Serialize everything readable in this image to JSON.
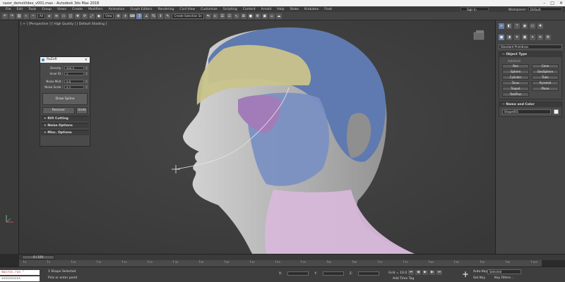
{
  "window": {
    "title": "razor_demoVideo_v001.max - Autodesk 3ds Max 2018"
  },
  "menu": [
    "File",
    "Edit",
    "Tools",
    "Group",
    "Views",
    "Create",
    "Modifiers",
    "Animation",
    "Graph Editors",
    "Rendering",
    "Civil View",
    "Customize",
    "Scripting",
    "Content",
    "Arnold",
    "Help",
    "Stoke",
    "Krakatoa",
    "Frost"
  ],
  "signin": "Sign In",
  "workspace": {
    "label": "Workspaces:",
    "value": "Default"
  },
  "toolbar": {
    "filter": "All",
    "view": "View",
    "selection_set": "Create Selection Se"
  },
  "viewport": {
    "label": "[ + ] [Perspective ] [ High Quality ] [ Default Shading ]"
  },
  "razor": {
    "title": "RaZoR",
    "close": "×",
    "params": [
      {
        "label": "Density :",
        "value": "400.0"
      },
      {
        "label": "Inner ID :",
        "value": "2"
      },
      {
        "label": "Noise Mult :",
        "value": "0.6"
      },
      {
        "label": "Noise Scale :",
        "value": "5.3"
      }
    ],
    "draw_button": "Draw Spline",
    "recover_button": "Recover",
    "undo_button": "Undo",
    "sections": [
      "Rift Cutting",
      "Noise Options",
      "Misc. Options"
    ]
  },
  "command_panel": {
    "dropdown": "Standard Primitives",
    "object_type": {
      "header": "Object Type",
      "autogrid": "AutoGrid",
      "buttons": [
        "Box",
        "Cone",
        "Sphere",
        "GeoSphere",
        "Cylinder",
        "Tube",
        "Torus",
        "Pyramid",
        "Teapot",
        "Plane",
        "TextPlus"
      ]
    },
    "name_color": {
      "header": "Name and Color",
      "name": "Shape001",
      "swatch_color": "#f5f5f5"
    }
  },
  "timeline": {
    "frame": "0 / 100",
    "ticks": [
      "0",
      "5",
      "10",
      "15",
      "20",
      "25",
      "30",
      "35",
      "40",
      "45",
      "50",
      "55",
      "60",
      "65",
      "70",
      "75",
      "80",
      "85",
      "90",
      "95",
      "100"
    ]
  },
  "status": {
    "script_a": "macros.run \"",
    "script_b": "ssssssssss",
    "line1": "1 Shape Selected",
    "line2": "Pick or enter point",
    "coords": {
      "x": "X:",
      "y": "Y:",
      "z": "Z:"
    },
    "grid": "Grid = 10.0",
    "add_time_tag": "Add Time Tag",
    "auto_key": "Auto Key",
    "selected": "Selected",
    "set_key": "Set Key",
    "key_filters": "Key Filters..."
  },
  "colors": {
    "accent": "#6a7fa8",
    "head_yellow": "#c9c38a",
    "head_blue": "#6f86b8",
    "head_purple": "#a27cb8",
    "head_pink": "#d7b8d9"
  }
}
